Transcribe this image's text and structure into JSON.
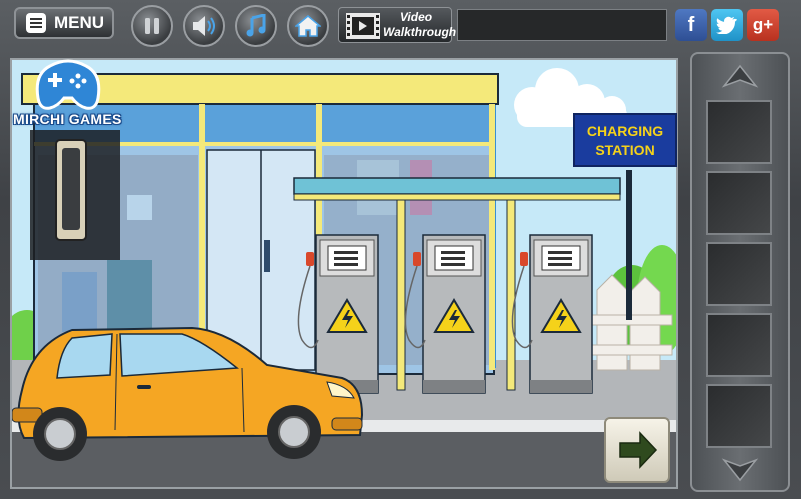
{
  "topbar": {
    "menu_label": "MENU",
    "video_label_line1": "Video",
    "video_label_line2": "Walkthrough",
    "buttons": [
      "pause-icon",
      "speaker-icon",
      "music-icon",
      "home-icon"
    ]
  },
  "social": {
    "facebook": "f",
    "googleplus": "g+"
  },
  "logo": {
    "text": "MIRCHI GAMES"
  },
  "scene": {
    "sign_line1": "CHARGING",
    "sign_line2": "STATION"
  },
  "colors": {
    "car": "#f5a623",
    "roof_frame": "#f4e97a",
    "sign_bg": "#1a3c9e",
    "sign_text": "#f5d21a"
  },
  "inventory": {
    "slot_count": 5
  }
}
